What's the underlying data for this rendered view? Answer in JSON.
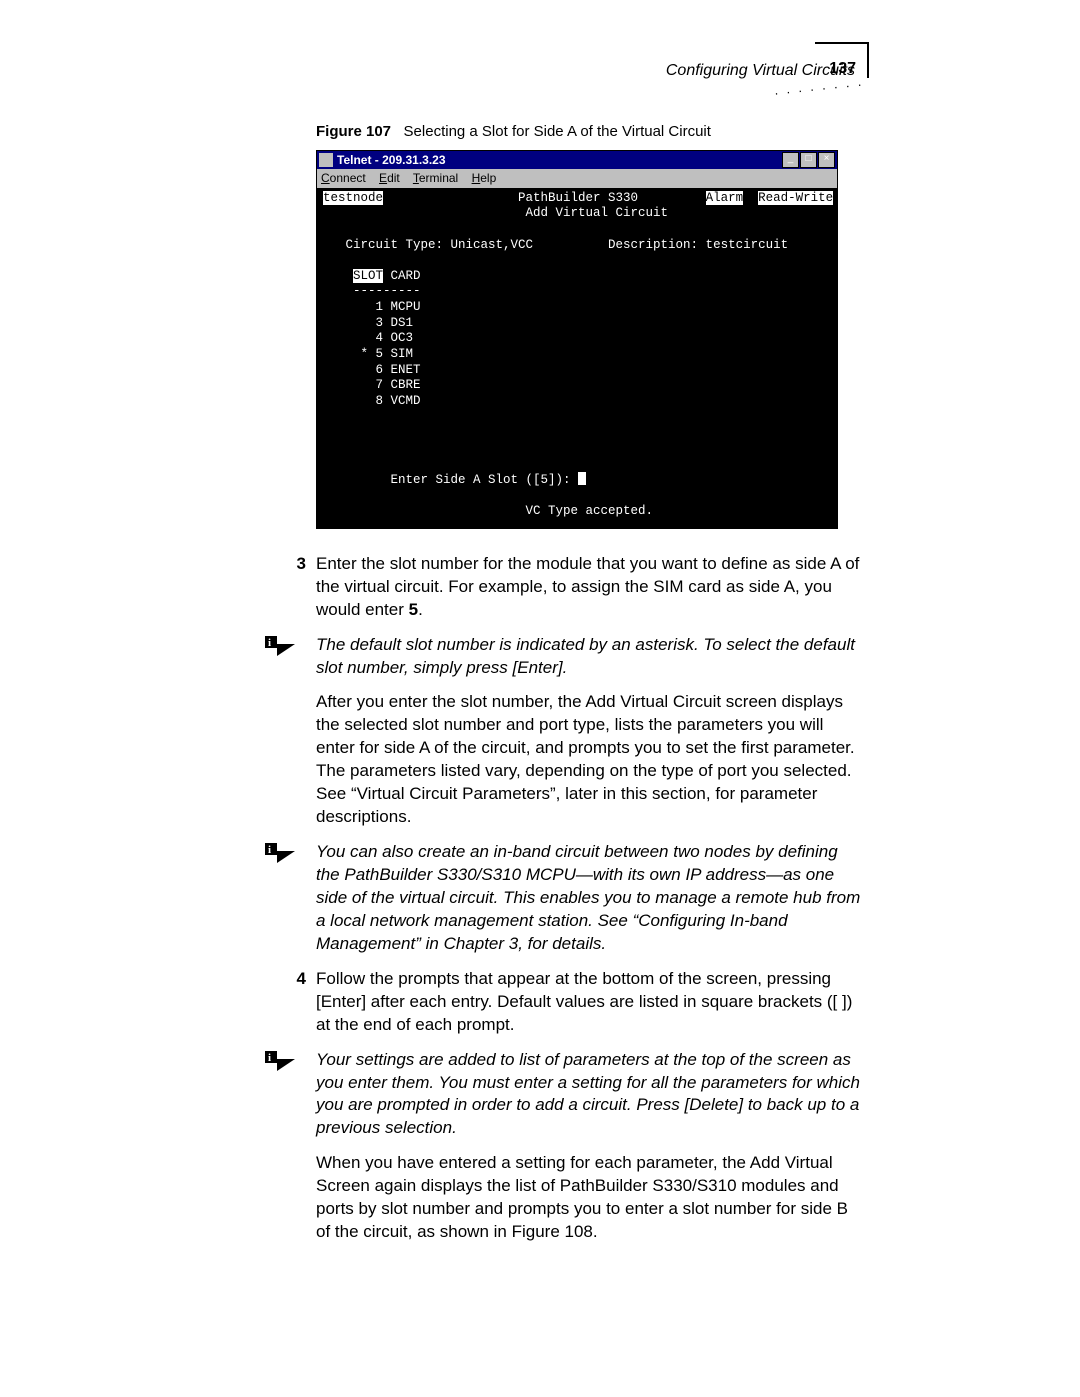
{
  "header": {
    "running_head": "Configuring Virtual Circuits",
    "page_number": "137"
  },
  "figure": {
    "label": "Figure 107",
    "caption": "Selecting a Slot for Side A of the Virtual Circuit"
  },
  "telnet": {
    "title": "Telnet - 209.31.3.23",
    "menu": {
      "connect": "Connect",
      "edit": "Edit",
      "terminal": "Terminal",
      "help": "Help"
    },
    "line_host": "testnode",
    "line_product": "PathBuilder S330",
    "line_alarm": "Alarm",
    "line_mode": "Read-Write",
    "line_subtitle": "Add Virtual Circuit",
    "circuit_type_label": "Circuit Type:",
    "circuit_type_val": "Unicast,VCC",
    "desc_label": "Description:",
    "desc_val": "testcircuit",
    "table_header_slot": "SLOT",
    "table_header_card": "CARD",
    "rows": [
      {
        "mark": " ",
        "slot": "1",
        "card": "MCPU"
      },
      {
        "mark": " ",
        "slot": "3",
        "card": "DS1"
      },
      {
        "mark": " ",
        "slot": "4",
        "card": "OC3"
      },
      {
        "mark": "*",
        "slot": "5",
        "card": "SIM"
      },
      {
        "mark": " ",
        "slot": "6",
        "card": "ENET"
      },
      {
        "mark": " ",
        "slot": "7",
        "card": "CBRE"
      },
      {
        "mark": " ",
        "slot": "8",
        "card": "VCMD"
      }
    ],
    "prompt": "Enter Side A Slot ([5]):",
    "status": "VC Type accepted."
  },
  "steps": {
    "s3_a": "Enter the slot number for the module that you want to define as side A of the virtual circuit. For example, to assign the SIM card as side A, you would enter ",
    "s3_bold": "5",
    "s3_b": ".",
    "note1": "The default slot number is indicated by an asterisk. To select the default slot number, simply press [Enter].",
    "p_after3": "After you enter the slot number, the Add Virtual Circuit screen displays the selected slot number and port type, lists the parameters you will enter for side A of the circuit, and prompts you to set the first parameter. The parameters listed vary, depending on the type of port you selected. See “Virtual Circuit Parameters”, later in this section, for parameter descriptions.",
    "note2": "You can also create an in-band circuit between two nodes by defining the PathBuilder S330/S310 MCPU—with its own IP address—as one side of the virtual circuit. This enables you to manage a remote hub from a local network management station. See “Configuring In-band Management” in Chapter 3, for details.",
    "s4": "Follow the prompts that appear at the bottom of the screen, pressing [Enter] after each entry. Default values are listed in square brackets ([ ]) at the end of each prompt.",
    "note3": "Your settings are added to list of parameters at the top of the screen as you enter them. You must enter a setting for all the parameters for which you are prompted in order to add a circuit. Press [Delete] to back up to a previous selection.",
    "p_after4": "When you have entered a setting for each parameter, the Add Virtual Screen again displays the list of PathBuilder S330/S310 modules and ports by slot number and prompts you to enter a slot number for side B of the circuit, as shown in Figure 108."
  }
}
